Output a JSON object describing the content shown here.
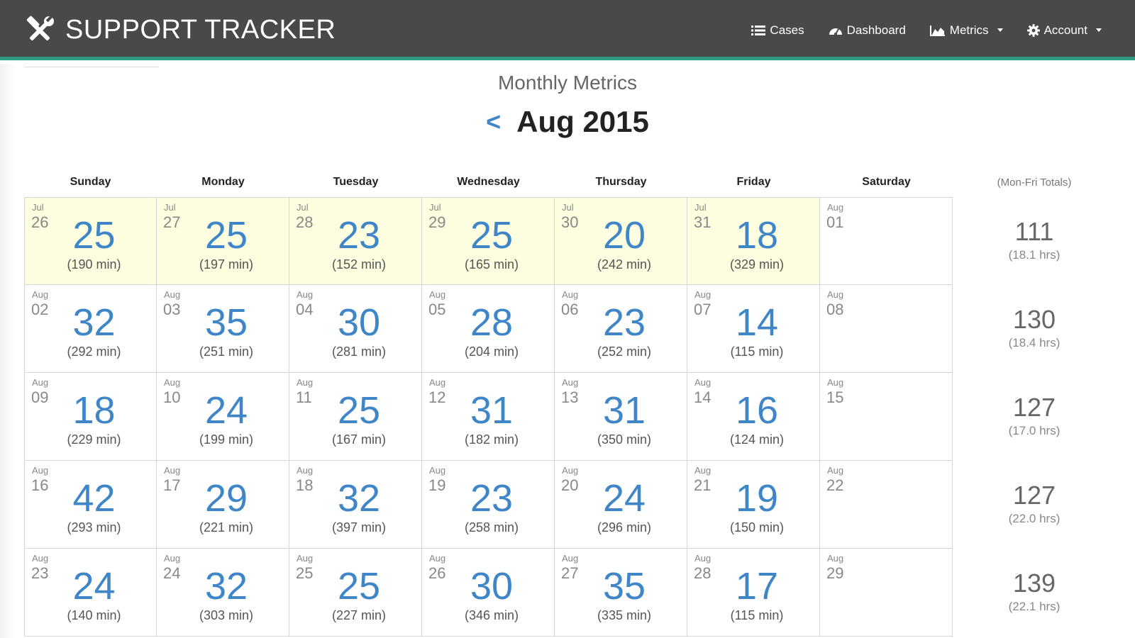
{
  "app": {
    "brand": "SUPPORT TRACKER"
  },
  "nav": [
    {
      "label": "Cases",
      "icon": "list-icon"
    },
    {
      "label": "Dashboard",
      "icon": "dashboard-icon"
    },
    {
      "label": "Metrics",
      "icon": "area-chart-icon",
      "dropdown": true
    },
    {
      "label": "Account",
      "icon": "gear-icon",
      "dropdown": true
    }
  ],
  "page": {
    "subtitle": "Monthly Metrics",
    "prev_label": "<",
    "month": "Aug 2015"
  },
  "calendar": {
    "headers": [
      "Sunday",
      "Monday",
      "Tuesday",
      "Wednesday",
      "Thursday",
      "Friday",
      "Saturday"
    ],
    "totals_header": "(Mon-Fri Totals)",
    "weeks": [
      {
        "days": [
          {
            "month": "Jul",
            "day": "26",
            "count": "25",
            "minutes": "(190 min)",
            "prev": true
          },
          {
            "month": "Jul",
            "day": "27",
            "count": "25",
            "minutes": "(197 min)",
            "prev": true
          },
          {
            "month": "Jul",
            "day": "28",
            "count": "23",
            "minutes": "(152 min)",
            "prev": true
          },
          {
            "month": "Jul",
            "day": "29",
            "count": "25",
            "minutes": "(165 min)",
            "prev": true
          },
          {
            "month": "Jul",
            "day": "30",
            "count": "20",
            "minutes": "(242 min)",
            "prev": true
          },
          {
            "month": "Jul",
            "day": "31",
            "count": "18",
            "minutes": "(329 min)",
            "prev": true
          },
          {
            "month": "Aug",
            "day": "01",
            "count": "",
            "minutes": "",
            "prev": false
          }
        ],
        "total": "111",
        "hours": "(18.1 hrs)"
      },
      {
        "days": [
          {
            "month": "Aug",
            "day": "02",
            "count": "32",
            "minutes": "(292 min)",
            "prev": false
          },
          {
            "month": "Aug",
            "day": "03",
            "count": "35",
            "minutes": "(251 min)",
            "prev": false
          },
          {
            "month": "Aug",
            "day": "04",
            "count": "30",
            "minutes": "(281 min)",
            "prev": false
          },
          {
            "month": "Aug",
            "day": "05",
            "count": "28",
            "minutes": "(204 min)",
            "prev": false
          },
          {
            "month": "Aug",
            "day": "06",
            "count": "23",
            "minutes": "(252 min)",
            "prev": false
          },
          {
            "month": "Aug",
            "day": "07",
            "count": "14",
            "minutes": "(115 min)",
            "prev": false
          },
          {
            "month": "Aug",
            "day": "08",
            "count": "",
            "minutes": "",
            "prev": false
          }
        ],
        "total": "130",
        "hours": "(18.4 hrs)"
      },
      {
        "days": [
          {
            "month": "Aug",
            "day": "09",
            "count": "18",
            "minutes": "(229 min)",
            "prev": false
          },
          {
            "month": "Aug",
            "day": "10",
            "count": "24",
            "minutes": "(199 min)",
            "prev": false
          },
          {
            "month": "Aug",
            "day": "11",
            "count": "25",
            "minutes": "(167 min)",
            "prev": false
          },
          {
            "month": "Aug",
            "day": "12",
            "count": "31",
            "minutes": "(182 min)",
            "prev": false
          },
          {
            "month": "Aug",
            "day": "13",
            "count": "31",
            "minutes": "(350 min)",
            "prev": false
          },
          {
            "month": "Aug",
            "day": "14",
            "count": "16",
            "minutes": "(124 min)",
            "prev": false
          },
          {
            "month": "Aug",
            "day": "15",
            "count": "",
            "minutes": "",
            "prev": false
          }
        ],
        "total": "127",
        "hours": "(17.0 hrs)"
      },
      {
        "days": [
          {
            "month": "Aug",
            "day": "16",
            "count": "42",
            "minutes": "(293 min)",
            "prev": false
          },
          {
            "month": "Aug",
            "day": "17",
            "count": "29",
            "minutes": "(221 min)",
            "prev": false
          },
          {
            "month": "Aug",
            "day": "18",
            "count": "32",
            "minutes": "(397 min)",
            "prev": false
          },
          {
            "month": "Aug",
            "day": "19",
            "count": "23",
            "minutes": "(258 min)",
            "prev": false
          },
          {
            "month": "Aug",
            "day": "20",
            "count": "24",
            "minutes": "(296 min)",
            "prev": false
          },
          {
            "month": "Aug",
            "day": "21",
            "count": "19",
            "minutes": "(150 min)",
            "prev": false
          },
          {
            "month": "Aug",
            "day": "22",
            "count": "",
            "minutes": "",
            "prev": false
          }
        ],
        "total": "127",
        "hours": "(22.0 hrs)"
      },
      {
        "days": [
          {
            "month": "Aug",
            "day": "23",
            "count": "24",
            "minutes": "(140 min)",
            "prev": false
          },
          {
            "month": "Aug",
            "day": "24",
            "count": "32",
            "minutes": "(303 min)",
            "prev": false
          },
          {
            "month": "Aug",
            "day": "25",
            "count": "25",
            "minutes": "(227 min)",
            "prev": false
          },
          {
            "month": "Aug",
            "day": "26",
            "count": "30",
            "minutes": "(346 min)",
            "prev": false
          },
          {
            "month": "Aug",
            "day": "27",
            "count": "35",
            "minutes": "(335 min)",
            "prev": false
          },
          {
            "month": "Aug",
            "day": "28",
            "count": "17",
            "minutes": "(115 min)",
            "prev": false
          },
          {
            "month": "Aug",
            "day": "29",
            "count": "",
            "minutes": "",
            "prev": false
          }
        ],
        "total": "139",
        "hours": "(22.1 hrs)"
      }
    ]
  },
  "colors": {
    "navbar": "#484a47",
    "accent_bar": "#2f9a83",
    "count_blue": "#3f86c8",
    "prev_month_bg": "#fdfde0"
  }
}
